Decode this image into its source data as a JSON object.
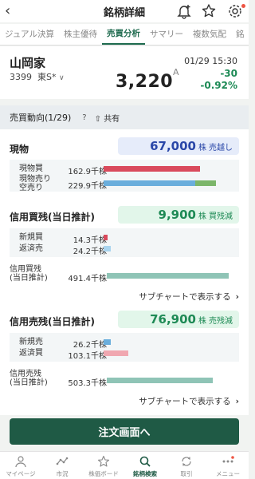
{
  "header": {
    "title": "銘柄詳細"
  },
  "tabs": [
    "ジュアル決算",
    "株主優待",
    "売買分析",
    "サマリー",
    "複数気配",
    "銘"
  ],
  "stock": {
    "name": "山岡家",
    "code": "3399",
    "market": "東S*",
    "price": "3,220",
    "price_flag": "A",
    "time": "01/29 15:30",
    "change": "-30",
    "change_pct": "-0.92%"
  },
  "panel": {
    "heading": "売買動向(1/29)",
    "help": "?",
    "share": "共有",
    "genbutsu": {
      "title": "現物",
      "value": "67,000",
      "unit": "株",
      "tag": "売越し",
      "rows": [
        {
          "label": "現物買",
          "amount": "162.9千株",
          "fraction": 0.71
        },
        {
          "label": "現物売り\n空売り",
          "amount": "229.9千株",
          "fraction": 0.83,
          "fraction2": 0.15
        }
      ]
    },
    "shinyou_buy": {
      "title": "信用買残(当日推計)",
      "value": "9,900",
      "unit": "株",
      "tag": "買残減",
      "rows": [
        {
          "label": "新規買",
          "amount": "14.3千株",
          "fraction": 0.03
        },
        {
          "label": "返済売",
          "amount": "24.2千株",
          "fraction": 0.05
        }
      ],
      "total_label": "信用買残\n(当日推計)",
      "total_amount": "491.4千株",
      "total_fraction": 0.98,
      "subchart": "サブチャートで表示する"
    },
    "shinyou_sell": {
      "title": "信用売残(当日推計)",
      "value": "76,900",
      "unit": "株",
      "tag": "売残減",
      "rows": [
        {
          "label": "新規売",
          "amount": "26.2千株",
          "fraction": 0.05
        },
        {
          "label": "返済買",
          "amount": "103.1千株",
          "fraction": 0.18
        }
      ],
      "total_label": "信用売残\n(当日推計)",
      "total_amount": "503.3千株",
      "total_fraction": 0.85,
      "subchart": "サブチャートで表示する"
    }
  },
  "order_button": "注文画面へ",
  "bottom_nav": [
    {
      "label": "マイページ",
      "icon": "person-icon"
    },
    {
      "label": "市況",
      "icon": "market-icon"
    },
    {
      "label": "株価ボード",
      "icon": "star-icon"
    },
    {
      "label": "銘柄検索",
      "icon": "search-icon",
      "active": true
    },
    {
      "label": "取引",
      "icon": "trade-icon"
    },
    {
      "label": "メニュー",
      "icon": "menu-icon"
    }
  ],
  "colors": {
    "accent": "#1f5a45",
    "down": "#1d8a55",
    "buy_bar": "#d94a5c",
    "sell_bar": "#6aaedc",
    "short_bar": "#7cb66a",
    "total_bar": "#8fc4b6"
  }
}
